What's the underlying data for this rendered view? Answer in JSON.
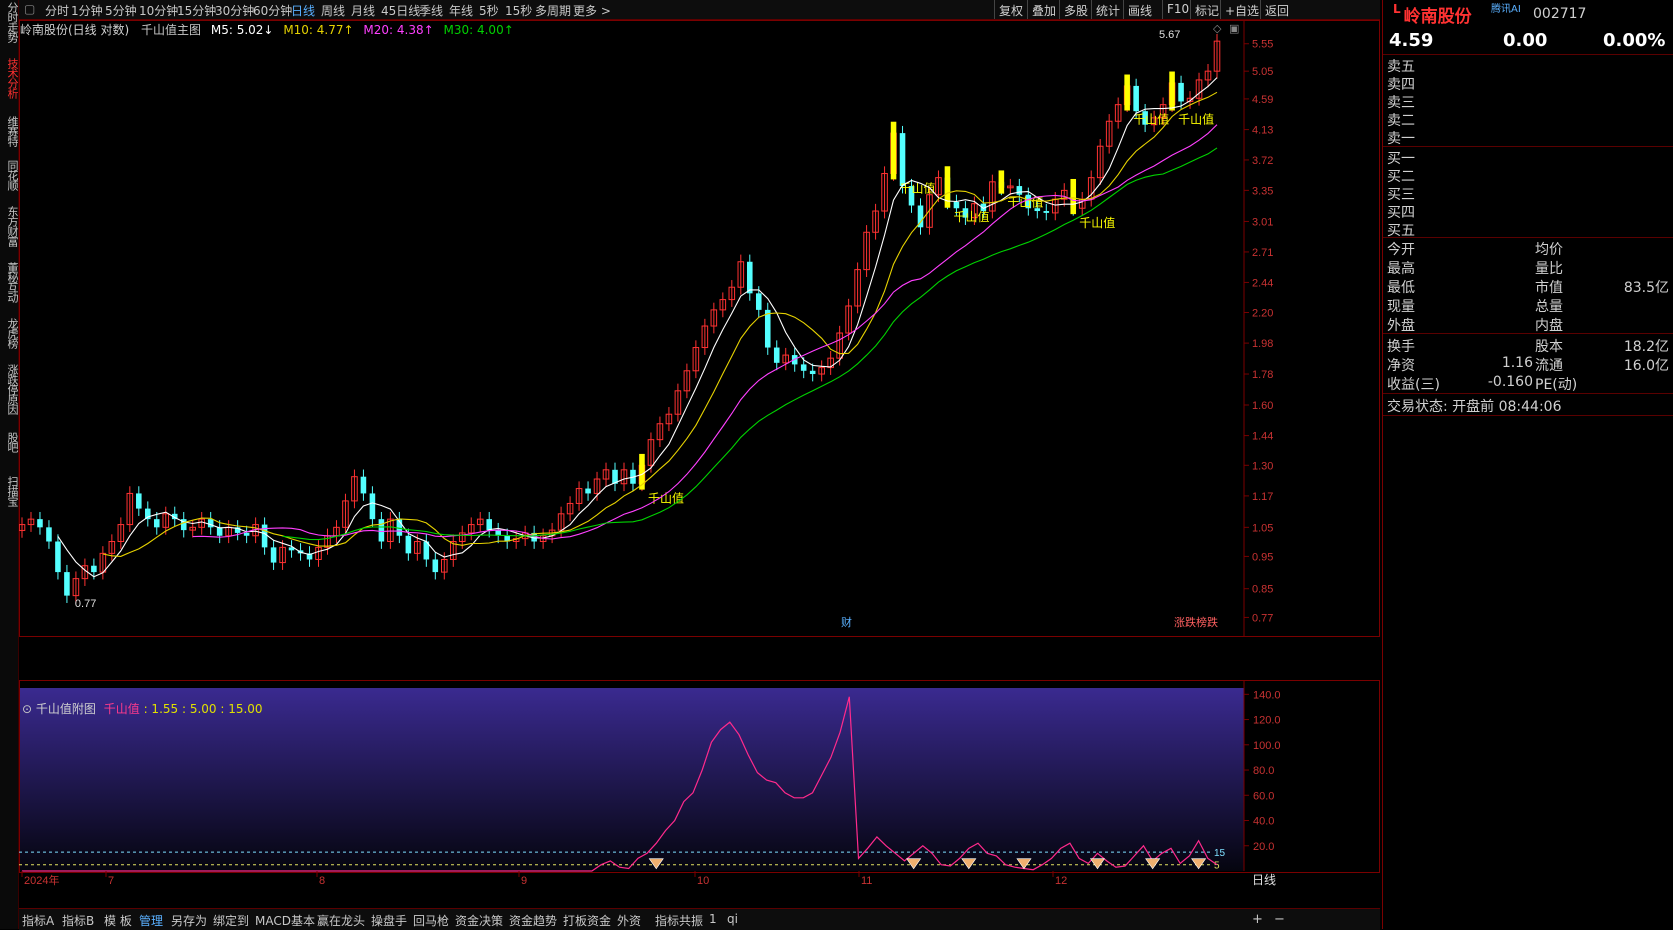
{
  "left_nav": [
    "分时走势",
    "技术分析",
    "维赛特",
    "同花顺",
    "东方财富",
    "董秘互动",
    "龙虎榜",
    "涨跌停原因",
    "股吧",
    "扫描宝"
  ],
  "left_nav_active": 1,
  "periods": [
    "分时",
    "1分钟",
    "5分钟",
    "10分钟",
    "15分钟",
    "30分钟",
    "60分钟",
    "日线",
    "周线",
    "月线",
    "45日线",
    "季线",
    "年线",
    "5秒",
    "15秒",
    "多周期",
    "更多 >"
  ],
  "active_period": "日线",
  "toolbar": [
    "复权",
    "叠加",
    "多股",
    "统计",
    "画线",
    "F10",
    "标记",
    "+自选",
    "返回"
  ],
  "main_legend": {
    "title": "岭南股份(日线 对数)",
    "indicator": "千山值主图",
    "m5": "M5: 5.02↓",
    "m10": "M10: 4.77↑",
    "m20": "M20: 4.38↑",
    "m30": "M30: 4.00↑"
  },
  "sub_legend": {
    "title": "千山值附图",
    "name": "千山值",
    "params": ": 1.55 : 5.00 : 15.00"
  },
  "stock": {
    "name": "岭南股份",
    "code": "002717",
    "badge": "腾讯AI",
    "price": "4.59",
    "change": "0.00",
    "pct": "0.00%"
  },
  "asks": [
    "卖五",
    "卖四",
    "卖三",
    "卖二",
    "卖一"
  ],
  "bids": [
    "买一",
    "买二",
    "买三",
    "买四",
    "买五"
  ],
  "info_rows": [
    {
      "l": "今开",
      "lv": "",
      "r": "均价",
      "rv": ""
    },
    {
      "l": "最高",
      "lv": "",
      "r": "量比",
      "rv": ""
    },
    {
      "l": "最低",
      "lv": "",
      "r": "市值",
      "rv": "83.5亿"
    },
    {
      "l": "现量",
      "lv": "",
      "r": "总量",
      "rv": ""
    },
    {
      "l": "外盘",
      "lv": "",
      "r": "内盘",
      "rv": ""
    }
  ],
  "info_rows2": [
    {
      "l": "换手",
      "lv": "",
      "r": "股本",
      "rv": "18.2亿"
    },
    {
      "l": "净资",
      "lv": "1.16",
      "r": "流通",
      "rv": "16.0亿"
    },
    {
      "l": "收益(三)",
      "lv": "-0.160",
      "r": "PE(动)",
      "rv": ""
    }
  ],
  "trade_status": "交易状态: 开盘前 08:44:06",
  "bottom_tabs": [
    "指标A",
    "指标B",
    "模 板",
    "管理",
    "另存为",
    "绑定到",
    "MACD基本",
    "赢在龙头",
    "操盘手",
    "回马枪",
    "资金决策",
    "资金趋势",
    "打板资金",
    "外资",
    "指标共振",
    "1",
    "qi"
  ],
  "bottom_active": "管理",
  "bottom_right": {
    "label": "日线",
    "plus": "+",
    "minus": "−"
  },
  "chart_data": [
    {
      "type": "candlestick",
      "title": "岭南股份(日线 对数)",
      "log_scale": true,
      "y_ticks": [
        0.77,
        0.85,
        0.95,
        1.05,
        1.17,
        1.3,
        1.44,
        1.6,
        1.78,
        1.98,
        2.2,
        2.44,
        2.71,
        3.01,
        3.35,
        3.72,
        4.13,
        4.59,
        5.05,
        5.55
      ],
      "x_ticks": [
        "2024年",
        "7",
        "8",
        "9",
        "10",
        "11",
        "12"
      ],
      "annotations": {
        "high": "5.67",
        "low": "0.77",
        "signal": "千山值",
        "fin": "财",
        "zt": "涨跌榜跌"
      },
      "close": [
        1.06,
        1.08,
        1.05,
        1.0,
        0.9,
        0.83,
        0.88,
        0.92,
        0.9,
        0.96,
        1.0,
        1.06,
        1.18,
        1.12,
        1.08,
        1.05,
        1.1,
        1.08,
        1.04,
        1.05,
        1.08,
        1.05,
        1.02,
        1.05,
        1.03,
        1.02,
        1.06,
        0.98,
        0.93,
        0.98,
        0.97,
        0.96,
        0.94,
        0.98,
        1.02,
        1.05,
        1.15,
        1.25,
        1.18,
        1.08,
        1.0,
        1.08,
        1.02,
        0.96,
        1.0,
        0.94,
        0.9,
        0.94,
        1.0,
        1.03,
        1.06,
        1.08,
        1.04,
        1.02,
        1.0,
        1.01,
        1.03,
        1.0,
        1.02,
        1.04,
        1.1,
        1.14,
        1.2,
        1.18,
        1.24,
        1.28,
        1.22,
        1.28,
        1.22,
        1.3,
        1.42,
        1.5,
        1.55,
        1.68,
        1.8,
        1.95,
        2.1,
        2.22,
        2.3,
        2.4,
        2.62,
        2.35,
        2.22,
        1.95,
        1.85,
        1.9,
        1.84,
        1.8,
        1.78,
        1.82,
        1.88,
        2.05,
        2.25,
        2.55,
        2.9,
        3.12,
        3.55,
        4.08,
        3.4,
        3.18,
        2.95,
        3.3,
        3.5,
        3.22,
        3.15,
        3.05,
        3.2,
        3.12,
        3.45,
        3.38,
        3.4,
        3.3,
        3.15,
        3.12,
        3.1,
        3.25,
        3.35,
        3.15,
        3.25,
        3.5,
        3.9,
        4.25,
        4.5,
        4.8,
        4.4,
        4.2,
        4.3,
        4.5,
        4.85,
        4.55,
        4.6,
        4.9,
        5.05,
        5.6
      ]
    },
    {
      "type": "line",
      "title": "千山值附图",
      "y_ticks": [
        20.0,
        40.0,
        60.0,
        80.0,
        100.0,
        120.0,
        140.0
      ],
      "x_ticks": [
        "2024年",
        "7",
        "8",
        "9",
        "10",
        "11",
        "12"
      ],
      "ref_labels": [
        "15",
        "5"
      ],
      "x_label": "日线",
      "series": [
        {
          "name": "千山值",
          "values": [
            0,
            0,
            0,
            0,
            0,
            0,
            0,
            0,
            0,
            0,
            0,
            0,
            0,
            0,
            0,
            0,
            0,
            0,
            0,
            0,
            0,
            0,
            0,
            0,
            0,
            0,
            0,
            0,
            0,
            0,
            0,
            0,
            0,
            0,
            0,
            0,
            0,
            0,
            0,
            0,
            0,
            0,
            0,
            0,
            0,
            0,
            0,
            0,
            0,
            0,
            0,
            0,
            0,
            0,
            0,
            0,
            0,
            0,
            0,
            0,
            0,
            0,
            0,
            5,
            8,
            3,
            2,
            10,
            14,
            22,
            32,
            40,
            55,
            62,
            80,
            102,
            112,
            118,
            108,
            92,
            78,
            72,
            70,
            62,
            58,
            58,
            62,
            76,
            90,
            110,
            138,
            10,
            18,
            27,
            20,
            14,
            8,
            14,
            20,
            14,
            5,
            4,
            10,
            18,
            22,
            14,
            12,
            5,
            3,
            2,
            1,
            5,
            10,
            18,
            22,
            10,
            6,
            14,
            8,
            3,
            4,
            12,
            20,
            8,
            14,
            18,
            6,
            12,
            24,
            10,
            5
          ]
        }
      ],
      "signal_markers": [
        69,
        97,
        103,
        109,
        117,
        123,
        128
      ]
    }
  ],
  "colors": {
    "up": "#ff3232",
    "down": "#54ffff",
    "m5": "#ffffff",
    "m10": "#e6d200",
    "m20": "#ff40ff",
    "m30": "#00d200",
    "signal": "#ffff00",
    "accent": "#5ab0ff"
  }
}
